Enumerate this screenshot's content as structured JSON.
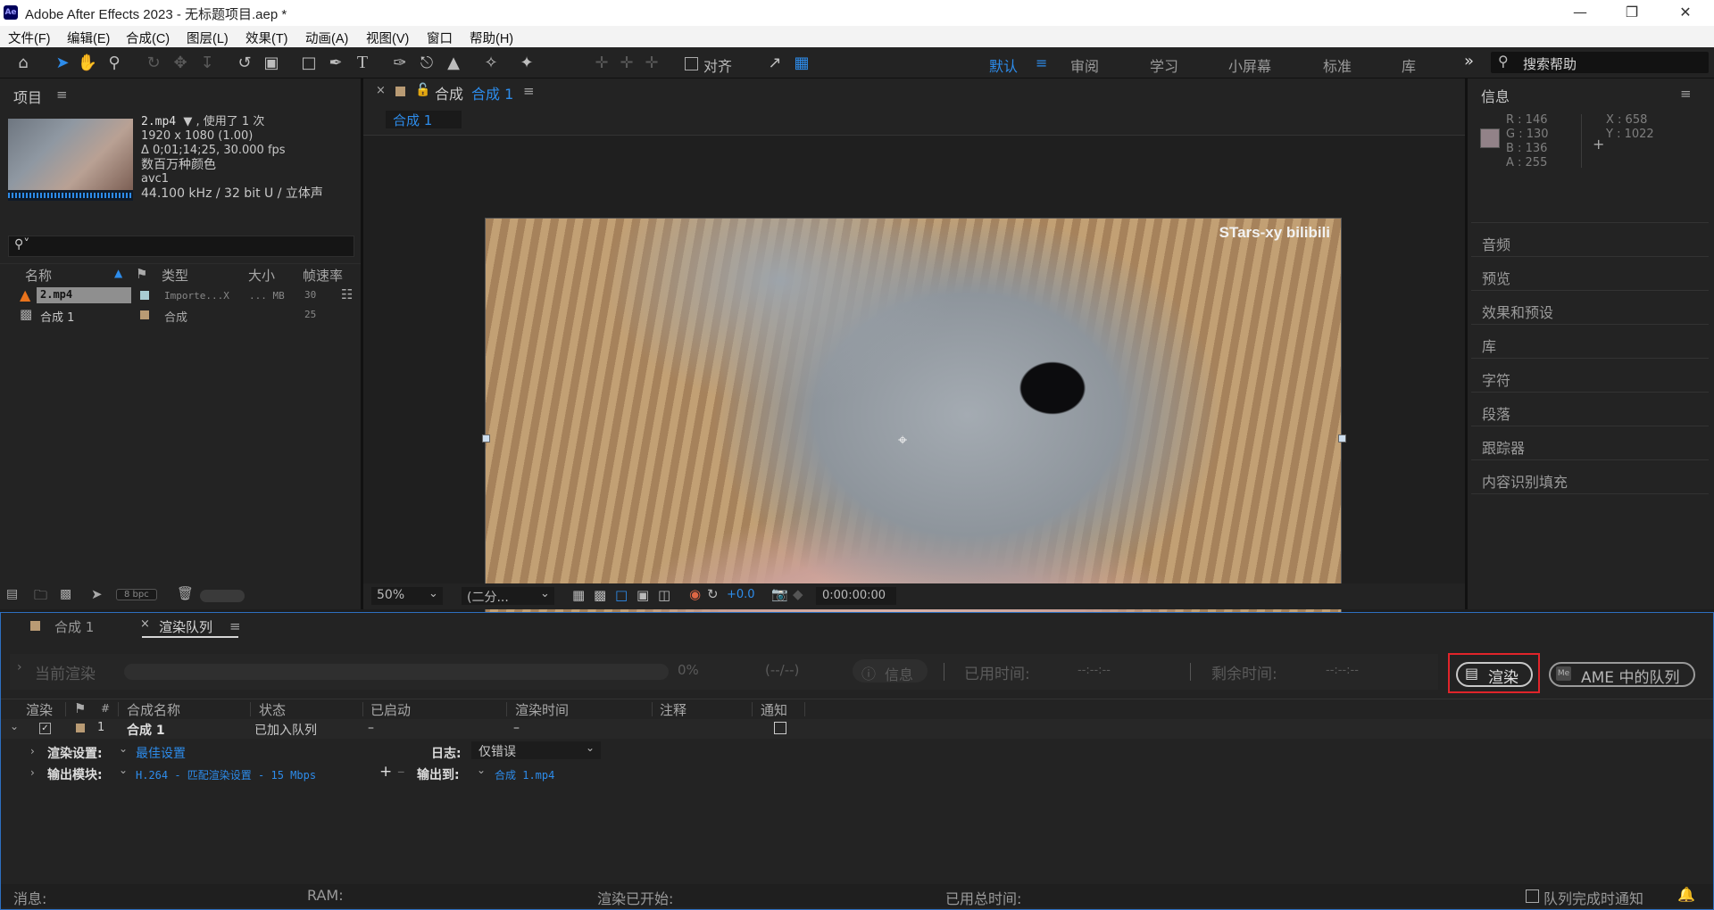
{
  "window": {
    "title": "Adobe After Effects 2023 - 无标题项目.aep *",
    "app_icon": "Ae",
    "controls": [
      "minimize-icon",
      "restore-icon",
      "close-icon"
    ]
  },
  "menu": [
    "文件(F)",
    "编辑(E)",
    "合成(C)",
    "图层(L)",
    "效果(T)",
    "动画(A)",
    "视图(V)",
    "窗口",
    "帮助(H)"
  ],
  "toolbar": {
    "snap_label": "对齐",
    "workspaces": [
      "默认",
      "审阅",
      "学习",
      "小屏幕",
      "标准",
      "库"
    ],
    "active_workspace": "默认",
    "more": "»",
    "help_search_placeholder": "搜索帮助"
  },
  "project": {
    "title": "项目",
    "selected": {
      "name": "2.mp4",
      "usage": "▼ , 使用了 1 次",
      "resolution": "1920 x 1080 (1.00)",
      "duration": "Δ 0;01;14;25, 30.000 fps",
      "colors": "数百万种颜色",
      "codec": "avc1",
      "audio": "44.100 kHz / 32 bit U / 立体声"
    },
    "search_placeholder": "",
    "columns": [
      "名称",
      "类型",
      "大小",
      "帧速率"
    ],
    "items": [
      {
        "name": "2.mp4",
        "type": "Importe...X",
        "size": "... MB",
        "fps": "30",
        "label_color": "#a9cdd3"
      },
      {
        "name": "合成 1",
        "type": "合成",
        "size": "",
        "fps": "25",
        "label_color": "#b99b74"
      }
    ],
    "bpc": "8 bpc"
  },
  "composition": {
    "tab_prefix": "合成",
    "tab_name": "合成 1",
    "sub_tab": "合成 1",
    "watermark": "STars-xy bilibili",
    "zoom": "50%",
    "resolution": "(二分...",
    "exposure": "+0.0",
    "timecode": "0:00:00:00"
  },
  "info": {
    "title": "信息",
    "r": "R : 146",
    "g": "G : 130",
    "b": "B : 136",
    "a": "A : 255",
    "x": "X : 658",
    "y": "Y : 1022",
    "swatch": "#928288",
    "panels": [
      "音频",
      "预览",
      "效果和预设",
      "库",
      "字符",
      "段落",
      "跟踪器",
      "内容识别填充"
    ]
  },
  "bottom_tabs": {
    "tab1": "合成 1",
    "tab2": "渲染队列"
  },
  "render": {
    "current_label": "当前渲染",
    "progress_percent": "0%",
    "progress_fraction": 0,
    "frames": "(--/--)",
    "info_btn": "信息",
    "elapsed_label": "已用时间:",
    "elapsed_value": "--:--:--",
    "remaining_label": "剩余时间:",
    "remaining_value": "--:--:--",
    "render_btn": "渲染",
    "ame_btn": "AME 中的队列",
    "columns": [
      "渲染",
      "#",
      "合成名称",
      "状态",
      "已启动",
      "渲染时间",
      "注释",
      "通知"
    ],
    "row": {
      "index": "1",
      "comp": "合成 1",
      "status": "已加入队列",
      "started": "–",
      "time": "–"
    },
    "settings_label": "渲染设置:",
    "settings_value": "最佳设置",
    "log_label": "日志:",
    "log_value": "仅错误",
    "output_module_label": "输出模块:",
    "output_module_value": "H.264 - 匹配渲染设置 - 15 Mbps",
    "output_to_label": "输出到:",
    "output_to_value": "合成 1.mp4"
  },
  "status_bar": {
    "message": "消息:",
    "ram": "RAM:",
    "render_started": "渲染已开始:",
    "total_time": "已用总时间:",
    "notify": "队列完成时通知"
  }
}
